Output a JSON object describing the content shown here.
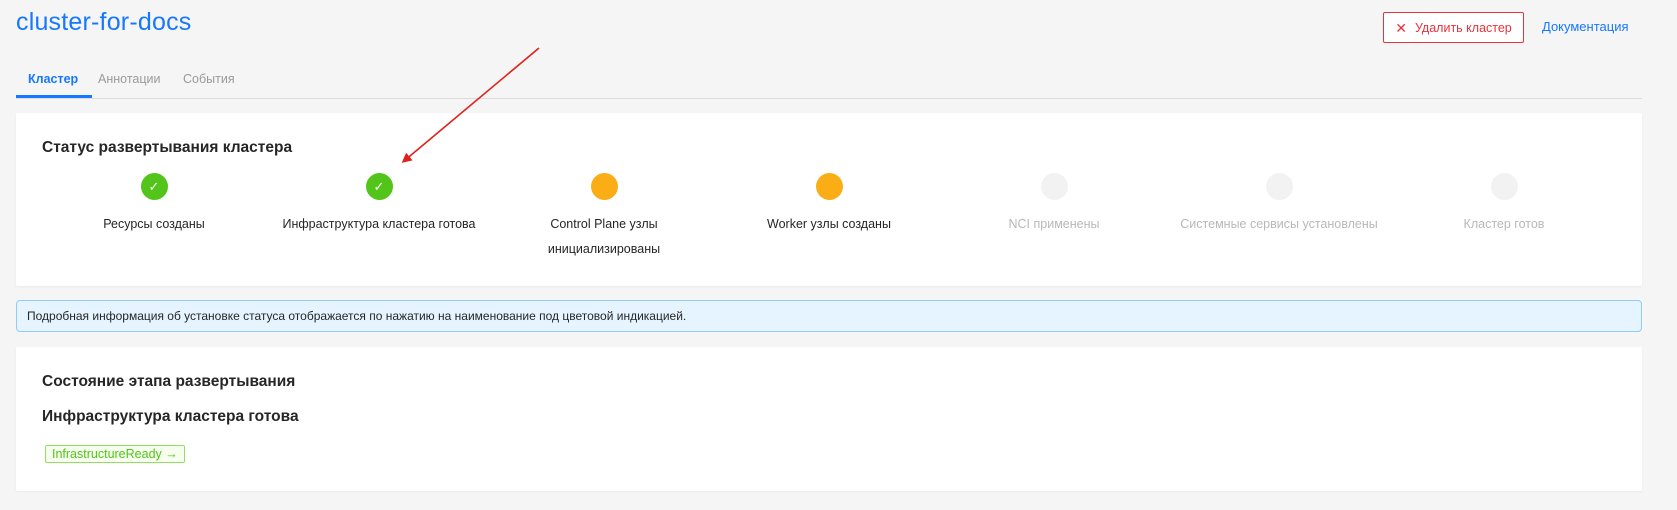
{
  "header": {
    "title": "cluster-for-docs",
    "delete_button": {
      "icon": "close-icon",
      "glyph": "✕",
      "label": "Удалить кластер"
    },
    "docs_link": "Документация"
  },
  "tabs": [
    {
      "label": "Кластер",
      "active": true
    },
    {
      "label": "Аннотации",
      "active": false
    },
    {
      "label": "События",
      "active": false
    }
  ],
  "status": {
    "title": "Статус развертывания кластера",
    "steps": [
      {
        "label": "Ресурсы созданы",
        "state": "done",
        "glyph": "✓"
      },
      {
        "label": "Инфраструктура кластера готова",
        "state": "done",
        "glyph": "✓"
      },
      {
        "label": "Control Plane узлы",
        "label2": "инициализированы",
        "state": "in-progress"
      },
      {
        "label": "Worker узлы созданы",
        "state": "in-progress"
      },
      {
        "label": "NCI применены",
        "state": "pending"
      },
      {
        "label": "Системные сервисы установлены",
        "state": "pending"
      },
      {
        "label": "Кластер готов",
        "state": "pending"
      }
    ]
  },
  "info": {
    "text": "Подробная информация об установке статуса отображается по нажатию на наименование под цветовой индикацией."
  },
  "stage": {
    "title": "Состояние этапа развертывания",
    "name": "Инфраструктура кластера готова",
    "condition": "InfrastructureReady →"
  },
  "colors": {
    "accent": "#1677ff",
    "danger": "#e8323c",
    "done": "#52c41a",
    "in_progress": "#faad14",
    "pending": "#f2f2f2",
    "annotation_arrow": "#e0201b"
  }
}
